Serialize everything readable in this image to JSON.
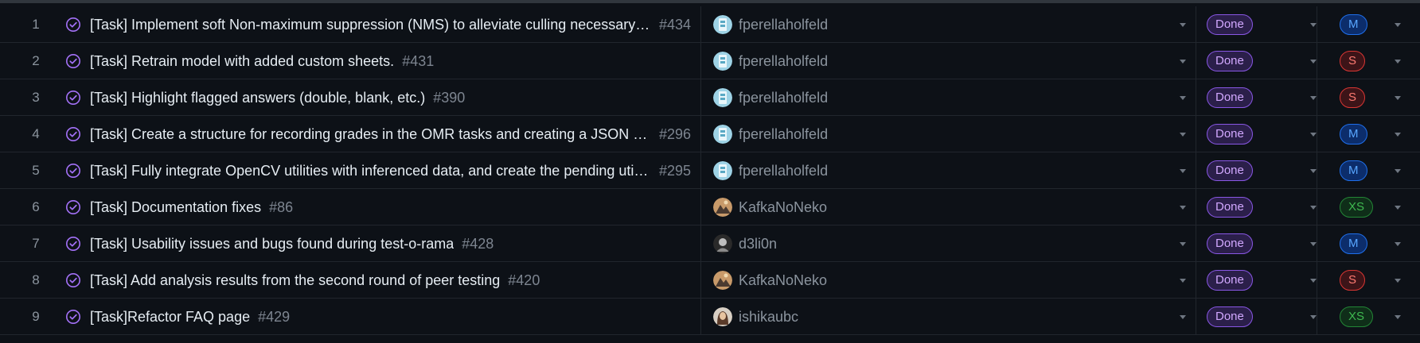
{
  "colors": {
    "background": "#0d1117",
    "done_accent": "#d2a8ff",
    "size_M": "#58a6ff",
    "size_S": "#ff7b72",
    "size_XS": "#3fb950"
  },
  "rows": [
    {
      "num": "1",
      "title": "[Task] Implement soft Non-maximum suppression (NMS) to alleviate culling necessary bo...",
      "issue": "#434",
      "assignee": "fperellaholfeld",
      "avatar_icon": "avatar-fperellaholfeld",
      "status": "Done",
      "size": "M"
    },
    {
      "num": "2",
      "title": "[Task] Retrain model with added custom sheets.",
      "issue": "#431",
      "assignee": "fperellaholfeld",
      "avatar_icon": "avatar-fperellaholfeld",
      "status": "Done",
      "size": "S"
    },
    {
      "num": "3",
      "title": "[Task] Highlight flagged answers (double, blank, etc.)",
      "issue": "#390",
      "assignee": "fperellaholfeld",
      "avatar_icon": "avatar-fperellaholfeld",
      "status": "Done",
      "size": "S"
    },
    {
      "num": "4",
      "title": "[Task] Create a structure for recording grades in the OMR tasks and creating a JSON Paylo...",
      "issue": "#296",
      "assignee": "fperellaholfeld",
      "avatar_icon": "avatar-fperellaholfeld",
      "status": "Done",
      "size": "M"
    },
    {
      "num": "5",
      "title": "[Task] Fully integrate OpenCV utilities with inferenced data, and create the pending utilitie...",
      "issue": "#295",
      "assignee": "fperellaholfeld",
      "avatar_icon": "avatar-fperellaholfeld",
      "status": "Done",
      "size": "M"
    },
    {
      "num": "6",
      "title": "[Task] Documentation fixes",
      "issue": "#86",
      "assignee": "KafkaNoNeko",
      "avatar_icon": "avatar-kafkanoneko",
      "status": "Done",
      "size": "XS"
    },
    {
      "num": "7",
      "title": "[Task] Usability issues and bugs found during test-o-rama",
      "issue": "#428",
      "assignee": "d3li0n",
      "avatar_icon": "avatar-d3li0n",
      "status": "Done",
      "size": "M"
    },
    {
      "num": "8",
      "title": "[Task] Add analysis results from the second round of peer testing",
      "issue": "#420",
      "assignee": "KafkaNoNeko",
      "avatar_icon": "avatar-kafkanoneko",
      "status": "Done",
      "size": "S"
    },
    {
      "num": "9",
      "title": "[Task]Refactor FAQ page",
      "issue": "#429",
      "assignee": "ishikaubc",
      "avatar_icon": "avatar-ishikaubc",
      "status": "Done",
      "size": "XS"
    }
  ]
}
